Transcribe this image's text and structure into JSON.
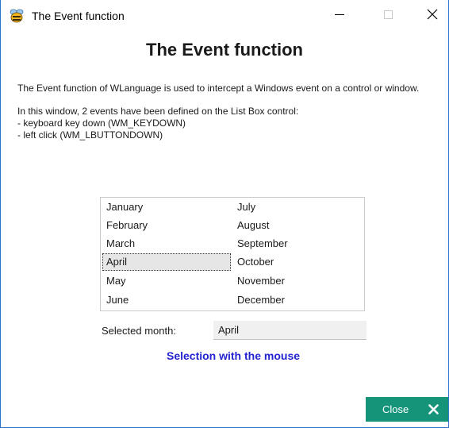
{
  "window": {
    "title": "The Event function"
  },
  "heading": "The Event function",
  "description": {
    "line1": "The Event function of WLanguage is used to intercept a Windows event on a control or window.",
    "line2": "In this window, 2 events have been defined on the List Box control:",
    "line3": "- keyboard key down (WM_KEYDOWN)",
    "line4": "- left click (WM_LBUTTONDOWN)"
  },
  "listbox": {
    "column1": [
      "January",
      "February",
      "March",
      "April",
      "May",
      "June"
    ],
    "column2": [
      "July",
      "August",
      "September",
      "October",
      "November",
      "December"
    ],
    "selected": "April"
  },
  "selected_month": {
    "label": "Selected month:",
    "value": "April"
  },
  "selection_message": "Selection with the mouse",
  "close_button": {
    "label": "Close"
  },
  "colors": {
    "accent": "#15947a",
    "message": "#2323d0",
    "window_border": "#2b73c4"
  },
  "icons": {
    "app": "windev-bee-icon",
    "minimize": "minimize-icon",
    "maximize": "maximize-icon",
    "close": "close-icon",
    "close_button": "x-icon"
  }
}
